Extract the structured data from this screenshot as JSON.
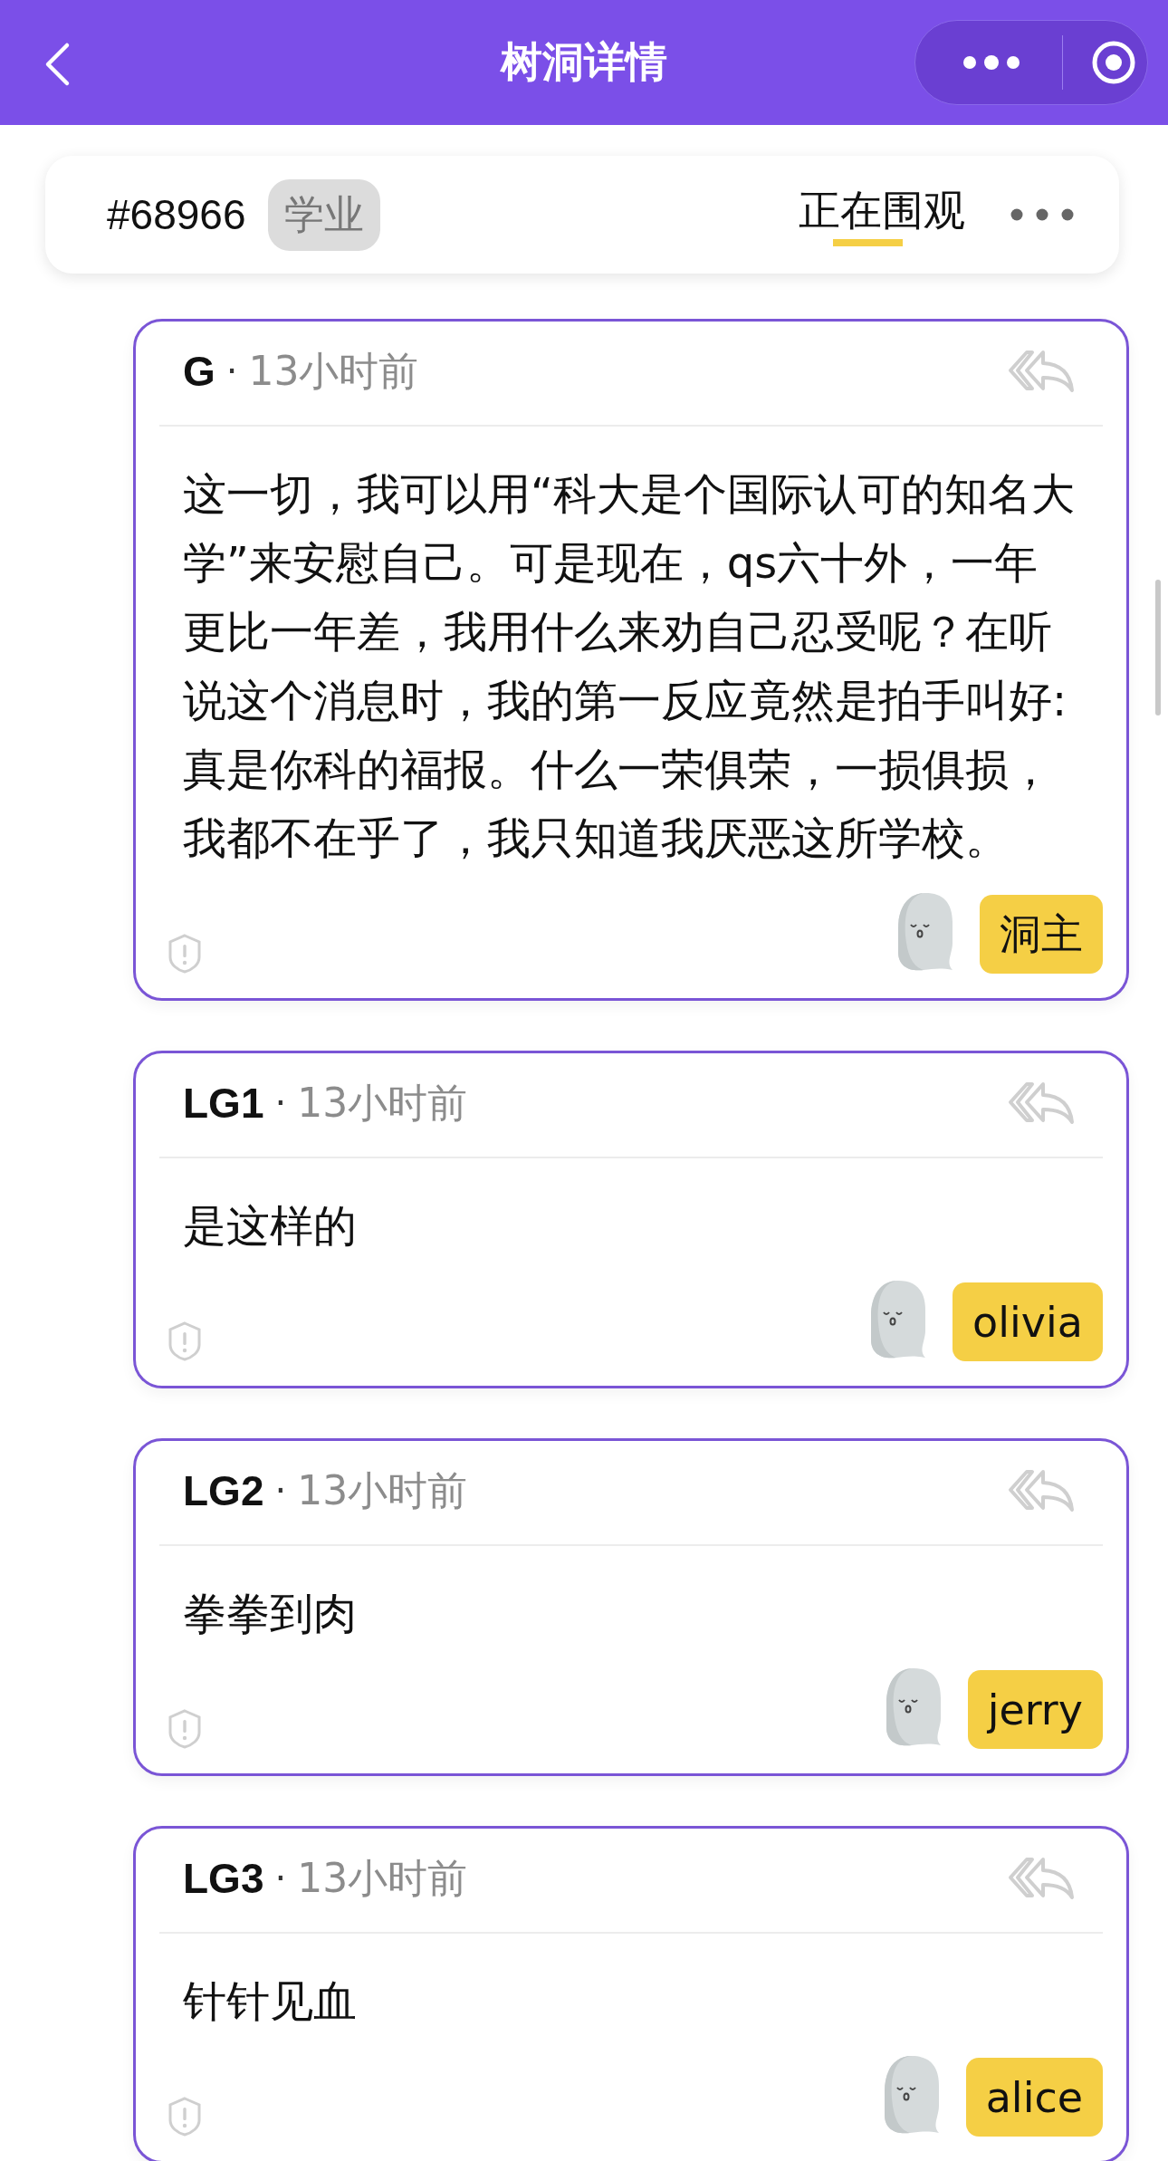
{
  "header": {
    "title": "树洞详情"
  },
  "post": {
    "id": "#68966",
    "tag": "学业",
    "watch_label": "正在围观"
  },
  "comments": [
    {
      "author": "G",
      "separator": "·",
      "time": "13小时前",
      "text": "这一切，我可以用“科大是个国际认可的知名大学”来安慰自己。可是现在，qs六十外，一年更比一年差，我用什么来劝自己忍受呢？在听说这个消息时，我的第一反应竟然是拍手叫好:真是你科的福报。什么一荣俱荣，一损俱损，我都不在乎了，我只知道我厌恶这所学校。",
      "badge": "洞主"
    },
    {
      "author": "LG1",
      "separator": "·",
      "time": "13小时前",
      "text": "是这样的",
      "badge": "olivia"
    },
    {
      "author": "LG2",
      "separator": "·",
      "time": "13小时前",
      "text": "拳拳到肉",
      "badge": "jerry"
    },
    {
      "author": "LG3",
      "separator": "·",
      "time": "13小时前",
      "text": "针针见血",
      "badge": "alice"
    }
  ]
}
